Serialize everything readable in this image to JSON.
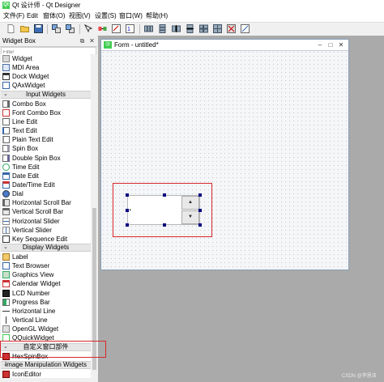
{
  "window": {
    "title": "Qt 设计师 - Qt Designer",
    "app_icon_text": "Qt"
  },
  "menu": [
    "文件(F)",
    "Edit",
    "窗体(O)",
    "视图(V)",
    "设置(S)",
    "窗口(W)",
    "帮助(H)"
  ],
  "widget_box": {
    "title": "Widget Box",
    "filter_placeholder": "Filter",
    "items": [
      {
        "type": "item",
        "label": "Widget",
        "icon": "widget-icon"
      },
      {
        "type": "item",
        "label": "MDI Area",
        "icon": "mdi-area-icon"
      },
      {
        "type": "item",
        "label": "Dock Widget",
        "icon": "dock-widget-icon"
      },
      {
        "type": "item",
        "label": "QAxWidget",
        "icon": "qaxwidget-icon"
      },
      {
        "type": "category",
        "label": "Input Widgets"
      },
      {
        "type": "item",
        "label": "Combo Box",
        "icon": "combo-box-icon"
      },
      {
        "type": "item",
        "label": "Font Combo Box",
        "icon": "font-combo-box-icon"
      },
      {
        "type": "item",
        "label": "Line Edit",
        "icon": "line-edit-icon"
      },
      {
        "type": "item",
        "label": "Text Edit",
        "icon": "text-edit-icon"
      },
      {
        "type": "item",
        "label": "Plain Text Edit",
        "icon": "plain-text-edit-icon"
      },
      {
        "type": "item",
        "label": "Spin Box",
        "icon": "spin-box-icon"
      },
      {
        "type": "item",
        "label": "Double Spin Box",
        "icon": "double-spin-box-icon"
      },
      {
        "type": "item",
        "label": "Time Edit",
        "icon": "time-edit-icon"
      },
      {
        "type": "item",
        "label": "Date Edit",
        "icon": "date-edit-icon"
      },
      {
        "type": "item",
        "label": "Date/Time Edit",
        "icon": "date-time-edit-icon"
      },
      {
        "type": "item",
        "label": "Dial",
        "icon": "dial-icon"
      },
      {
        "type": "item",
        "label": "Horizontal Scroll Bar",
        "icon": "horizontal-scroll-bar-icon"
      },
      {
        "type": "item",
        "label": "Vertical Scroll Bar",
        "icon": "vertical-scroll-bar-icon"
      },
      {
        "type": "item",
        "label": "Horizontal Slider",
        "icon": "horizontal-slider-icon"
      },
      {
        "type": "item",
        "label": "Vertical Slider",
        "icon": "vertical-slider-icon"
      },
      {
        "type": "item",
        "label": "Key Sequence Edit",
        "icon": "key-sequence-edit-icon"
      },
      {
        "type": "category",
        "label": "Display Widgets"
      },
      {
        "type": "item",
        "label": "Label",
        "icon": "label-icon"
      },
      {
        "type": "item",
        "label": "Text Browser",
        "icon": "text-browser-icon"
      },
      {
        "type": "item",
        "label": "Graphics View",
        "icon": "graphics-view-icon"
      },
      {
        "type": "item",
        "label": "Calendar Widget",
        "icon": "calendar-widget-icon"
      },
      {
        "type": "item",
        "label": "LCD Number",
        "icon": "lcd-number-icon"
      },
      {
        "type": "item",
        "label": "Progress Bar",
        "icon": "progress-bar-icon"
      },
      {
        "type": "item",
        "label": "Horizontal Line",
        "icon": "horizontal-line-icon"
      },
      {
        "type": "item",
        "label": "Vertical Line",
        "icon": "vertical-line-icon"
      },
      {
        "type": "item",
        "label": "OpenGL Widget",
        "icon": "opengl-widget-icon"
      },
      {
        "type": "item",
        "label": "QQuickWidget",
        "icon": "qquickwidget-icon"
      },
      {
        "type": "category",
        "label": "自定义窗口部件"
      },
      {
        "type": "item",
        "label": "HexSpinBox",
        "icon": "hexspinbox-icon"
      },
      {
        "type": "category",
        "label": "Image Manipulation Widgets"
      },
      {
        "type": "item",
        "label": "IconEditor",
        "icon": "icon-editor-icon"
      }
    ]
  },
  "form": {
    "title": "Form - untitled*",
    "icon_text": "Qt"
  },
  "spinbox": {
    "up_arrow": "▲",
    "down_arrow": "▼"
  },
  "watermark": "CSDN @李恩泽"
}
